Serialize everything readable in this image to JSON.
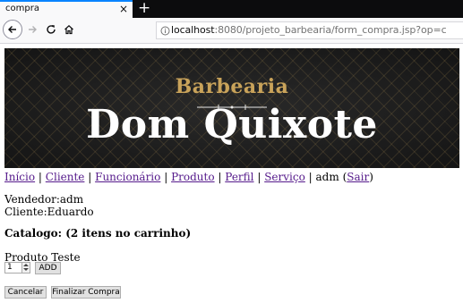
{
  "browser": {
    "tab_title": "compra",
    "tab_close": "×",
    "new_tab": "+",
    "url_host": "localhost",
    "url_path": ":8080/projeto_barbearia/form_compra.jsp?op=c"
  },
  "banner": {
    "top_text": "Barbearia",
    "main_text": "Dom Quixote"
  },
  "menu": {
    "items": [
      "Início",
      "Cliente",
      "Funcionário",
      "Produto",
      "Perfil",
      "Serviço"
    ],
    "separator": "|",
    "user": "adm",
    "logout_prefix": "(",
    "logout": "Sair",
    "logout_suffix": ")"
  },
  "info": {
    "vendedor": "Vendedor:adm",
    "cliente": "Cliente:Eduardo",
    "catalog": "Catalogo: (2 itens no carrinho)"
  },
  "product": {
    "name": "Produto Teste",
    "quantity": "1",
    "add_label": "ADD"
  },
  "actions": {
    "cancel_label": "Cancelar",
    "finish_label": "Finalizar Compra"
  },
  "icons": {
    "back": "back-arrow-icon",
    "forward": "forward-arrow-icon",
    "reload": "reload-icon",
    "home": "home-icon",
    "info": "info-icon"
  },
  "colors": {
    "tab_accent": "#0a84ff",
    "link": "#551a8b",
    "banner_gold": "#c9a35a"
  }
}
